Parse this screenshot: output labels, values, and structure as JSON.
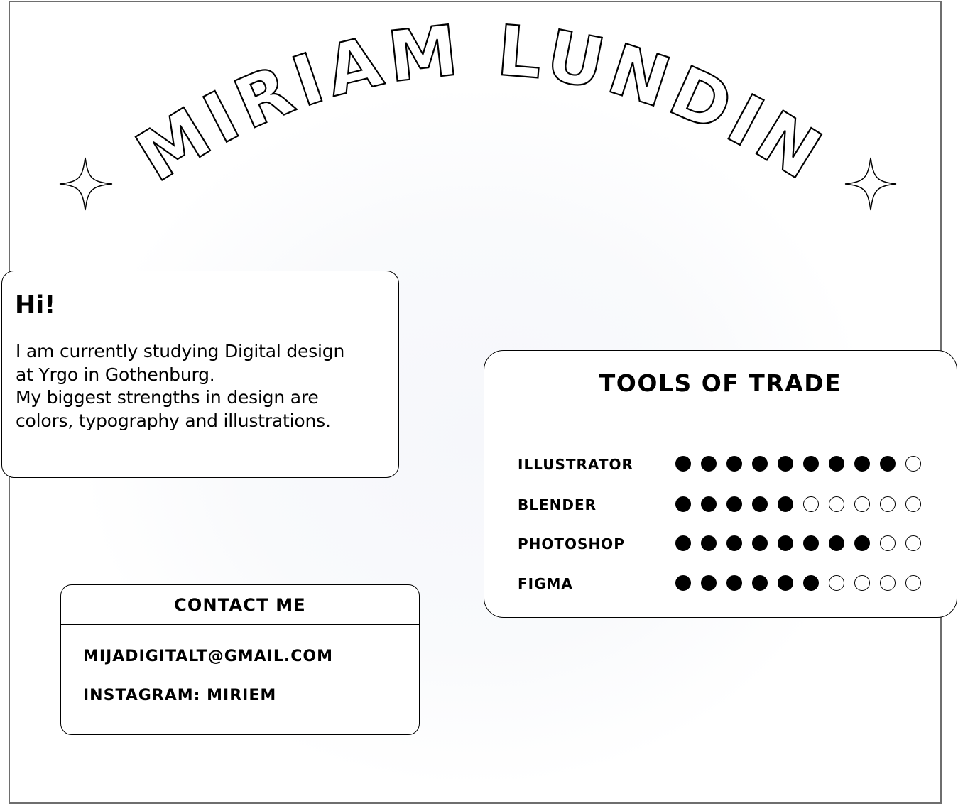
{
  "title": {
    "name": "MIRIAM LUNDIN"
  },
  "intro": {
    "greeting": "Hi!",
    "lines": [
      "I am currently studying Digital design",
      "at Yrgo in Gothenburg.",
      "My biggest strengths in design are",
      "colors, typography and illustrations."
    ]
  },
  "tools": {
    "heading": "TOOLS OF TRADE",
    "max_level": 10,
    "skills": [
      {
        "name": "ILLUSTRATOR",
        "level": 9
      },
      {
        "name": "BLENDER",
        "level": 5
      },
      {
        "name": "PHOTOSHOP",
        "level": 8
      },
      {
        "name": "FIGMA",
        "level": 6
      }
    ]
  },
  "contact": {
    "heading": "CONTACT ME",
    "email": "MIJADIGITALT@GMAIL.COM",
    "instagram": "INSTAGRAM: MIRIEM"
  },
  "colors": {
    "frame": "#6e6e6e",
    "ink": "#000000",
    "background": "#ffffff"
  },
  "icons": {
    "left": "sparkle-icon",
    "right": "sparkle-icon"
  }
}
